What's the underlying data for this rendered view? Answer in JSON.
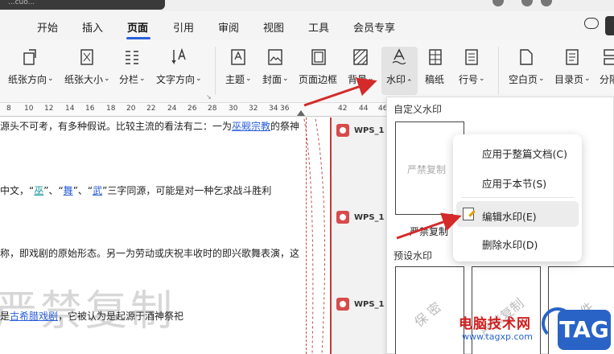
{
  "title_bar": {
    "doc_name": "...cuo..."
  },
  "menu": {
    "items": [
      "开始",
      "插入",
      "页面",
      "引用",
      "审阅",
      "视图",
      "工具",
      "会员专享"
    ],
    "active": "页面"
  },
  "ribbon": {
    "buttons": {
      "orientation": "纸张方向",
      "size": "纸张大小",
      "columns": "分栏",
      "text_direction": "文字方向",
      "theme": "主题",
      "cover": "封面",
      "page_border": "页面边框",
      "background": "背景",
      "watermark": "水印",
      "manuscript": "稿纸",
      "line_number": "行号",
      "blank_page": "空白页",
      "toc_page": "目录页",
      "section": "分隔"
    }
  },
  "ruler": {
    "ticks": [
      "8",
      "10",
      "12",
      "14",
      "16",
      "18",
      "20",
      "22",
      "24",
      "26",
      "28",
      "30",
      "32",
      "34",
      "36",
      "",
      "42",
      "44",
      "46"
    ]
  },
  "document": {
    "line1": "源头不可考，有多种假说。比较主流的看法有二：一为",
    "line1_link": "巫觋宗教",
    "line1_tail": "的祭神",
    "line2_pre": "中文，“",
    "line2_w1": "巫",
    "line2_mid1": "”、“",
    "line2_w2": "舞",
    "line2_mid2": "”、“",
    "line2_w3": "武",
    "line2_tail": "”三字同源，可能是对一种乞求战斗胜利",
    "line3": "称，即戏剧的原始形态。另一为劳动或庆祝丰收时的即兴歌舞表演，这",
    "line4_pre": "是",
    "line4_link": "古希腊戏剧",
    "line4_tail": "，它被认为是起源于酒神祭祀",
    "big_watermark": "严禁复制"
  },
  "comments": {
    "author": "WPS_1"
  },
  "watermark_panel": {
    "custom_header": "自定义水印",
    "custom_thumb_text": "严禁复制",
    "custom_label": "严禁复制",
    "preset_header": "预设水印",
    "preset_thumbs": [
      "保 密",
      "严禁复制",
      "原 件"
    ]
  },
  "context_menu": {
    "apply_all": "应用于整篇文档(C)",
    "apply_section": "应用于本节(S)",
    "edit": "编辑水印(E)",
    "delete": "删除水印(D)"
  },
  "site_logo": {
    "name": "电脑技术网",
    "url": "www.tagxp.com",
    "badge": "TAG"
  },
  "colors": {
    "accent": "#2b5fd9",
    "arrow": "#d42a2a",
    "logo_red": "#d02020",
    "logo_blue": "#2a63c6"
  }
}
